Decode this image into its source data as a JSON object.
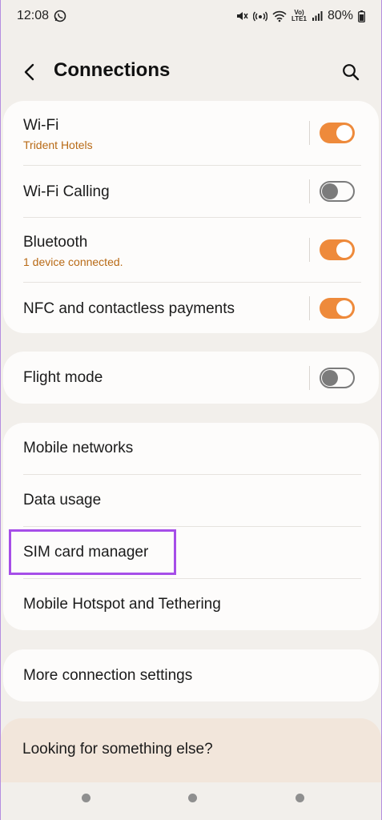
{
  "status_bar": {
    "time": "12:08",
    "lte_top": "Vo)",
    "lte_bottom": "LTE1",
    "battery": "80%",
    "icons": [
      "whatsapp-icon",
      "mute-icon",
      "hotspot-icon",
      "wifi-icon",
      "signal-icon",
      "battery-icon"
    ]
  },
  "header": {
    "title": "Connections",
    "back_icon": "back-arrow-icon",
    "search_icon": "search-icon"
  },
  "group1": [
    {
      "label": "Wi-Fi",
      "sub": "Trident Hotels",
      "toggle": true
    },
    {
      "label": "Wi-Fi Calling",
      "sub": "",
      "toggle": false
    },
    {
      "label": "Bluetooth",
      "sub": "1 device connected.",
      "toggle": true
    },
    {
      "label": "NFC and contactless payments",
      "sub": "",
      "toggle": true
    }
  ],
  "group2": [
    {
      "label": "Flight mode",
      "toggle": false
    }
  ],
  "group3": [
    {
      "label": "Mobile networks"
    },
    {
      "label": "Data usage"
    },
    {
      "label": "SIM card manager"
    },
    {
      "label": "Mobile Hotspot and Tethering"
    }
  ],
  "group4": [
    {
      "label": "More connection settings"
    }
  ],
  "looking": {
    "label": "Looking for something else?"
  },
  "colors": {
    "accent": "#ee8a3b",
    "subtext": "#b86a16",
    "highlight": "#a64ee8",
    "background": "#f2efeb"
  }
}
